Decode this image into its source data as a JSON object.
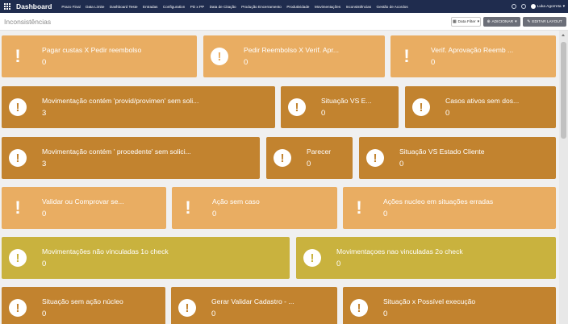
{
  "nav": {
    "brand": "Dashboard",
    "menu": [
      "Prazo Final",
      "Data Limite",
      "Dashboard Teste",
      "Entradas",
      "Configuration",
      "PD x PP",
      "Data de Citação",
      "Produção Encerramento",
      "Produtividade",
      "Movimentações",
      "Inconsistências",
      "Gestão de Acordos"
    ],
    "user": "Luka Agorreta"
  },
  "subheader": {
    "title": "Inconsistências",
    "filter_label": "Data Filter",
    "add_label": "ADICIONAR",
    "edit_label": "EDITAR LAYOUT"
  },
  "colors": {
    "light_orange": "#e9ad62",
    "dark_orange": "#c2832f",
    "olive": "#c9b23e"
  },
  "cards": [
    {
      "title": "Pagar custas X Pedir reembolso",
      "value": "0",
      "icon": "exclamation-icon"
    },
    {
      "title": "Pedir Reembolso X Verif. Apr...",
      "value": "0",
      "icon": "exclamation-circle-icon"
    },
    {
      "title": "Verif. Aprovação Reemb ...",
      "value": "0",
      "icon": "exclamation-icon"
    },
    {
      "title": "Movimentação contém 'provid/provimen' sem soli...",
      "value": "3",
      "icon": "exclamation-circle-icon"
    },
    {
      "title": "Situação VS E...",
      "value": "0",
      "icon": "exclamation-circle-icon"
    },
    {
      "title": "Casos ativos sem dos...",
      "value": "0",
      "icon": "exclamation-circle-icon"
    },
    {
      "title": "Movimentação contém ' procedente' sem solici...",
      "value": "3",
      "icon": "exclamation-circle-icon"
    },
    {
      "title": "Parecer",
      "value": "0",
      "icon": "exclamation-circle-icon"
    },
    {
      "title": "Situação VS Estado Cliente",
      "value": "0",
      "icon": "exclamation-circle-icon"
    },
    {
      "title": "Validar ou Comprovar se...",
      "value": "0",
      "icon": "exclamation-icon"
    },
    {
      "title": "Ação sem caso",
      "value": "0",
      "icon": "exclamation-icon"
    },
    {
      "title": "Ações nucleo em situações erradas",
      "value": "0",
      "icon": "exclamation-icon"
    },
    {
      "title": "Movimentações não vinculadas 1o check",
      "value": "0",
      "icon": "exclamation-circle-icon"
    },
    {
      "title": "Movimentaçoes nao vinculadas 2o check",
      "value": "0",
      "icon": "exclamation-circle-icon"
    },
    {
      "title": "Situação sem ação núcleo",
      "value": "0",
      "icon": "exclamation-circle-icon"
    },
    {
      "title": "Gerar Validar Cadastro - ...",
      "value": "0",
      "icon": "exclamation-circle-icon"
    },
    {
      "title": "Situação x Possível execução",
      "value": "0",
      "icon": "exclamation-circle-icon"
    }
  ]
}
